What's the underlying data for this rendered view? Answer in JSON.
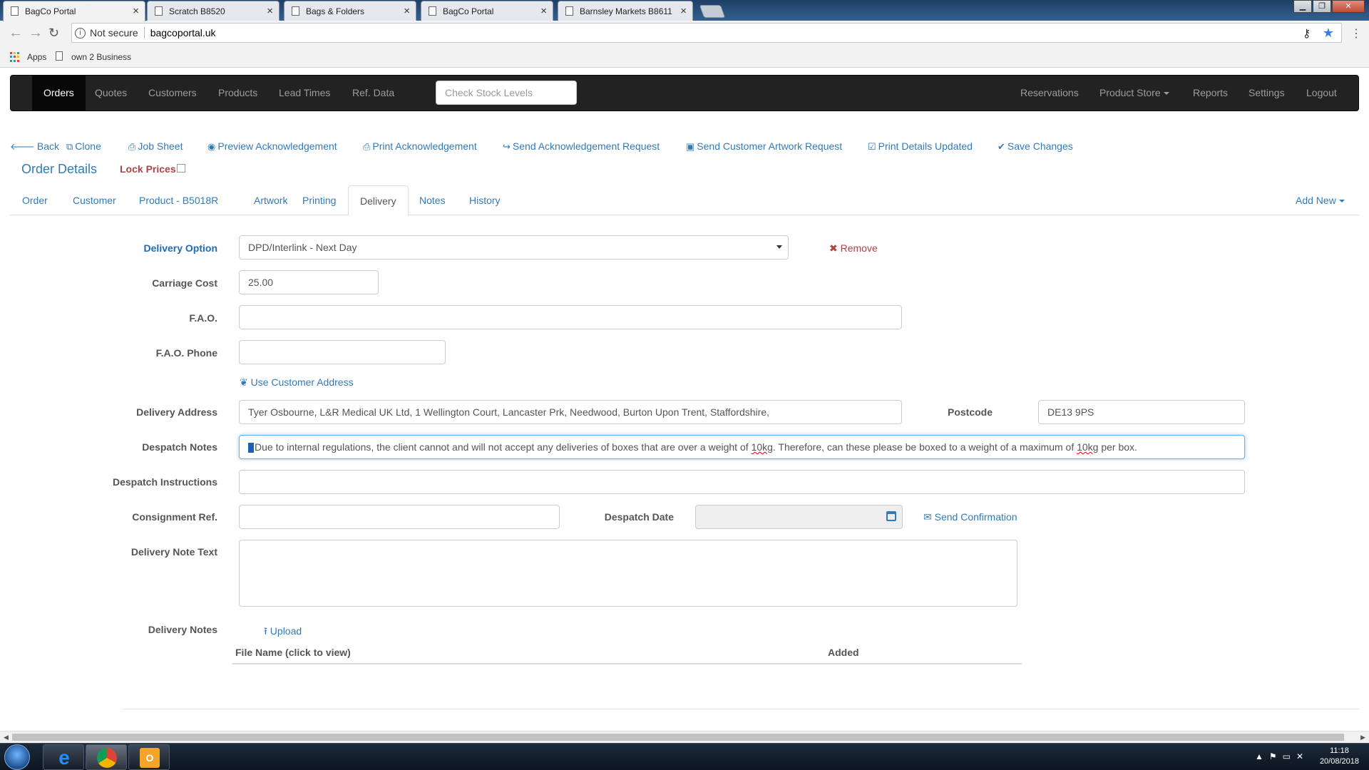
{
  "browser": {
    "tabs": [
      {
        "title": "BagCo Portal",
        "active": true
      },
      {
        "title": "Scratch B8520",
        "active": false
      },
      {
        "title": "Bags & Folders",
        "active": false
      },
      {
        "title": "BagCo Portal",
        "active": false
      },
      {
        "title": "Barnsley Markets B8611",
        "active": false
      }
    ],
    "security_label": "Not secure",
    "url": "bagcoportal.uk",
    "bookmarks": [
      "Apps",
      "own 2 Business"
    ]
  },
  "navbar": {
    "left_items": [
      "Orders",
      "Quotes",
      "Customers",
      "Products",
      "Lead Times",
      "Ref. Data"
    ],
    "active": "Orders",
    "search_placeholder": "Check Stock Levels",
    "right_items": [
      "Reservations",
      "Product Store",
      "Reports",
      "Settings",
      "Logout"
    ]
  },
  "toolbar": {
    "back": "Back",
    "clone": "Clone",
    "job_sheet": "Job Sheet",
    "preview_ack": "Preview Acknowledgement",
    "print_ack": "Print Acknowledgement",
    "send_ack_request": "Send Acknowledgement Request",
    "send_artwork_request": "Send Customer Artwork Request",
    "print_details_updated": "Print Details Updated",
    "save_changes": "Save Changes"
  },
  "header": {
    "title": "Order Details",
    "lock_prices": "Lock Prices"
  },
  "tabs": {
    "items": [
      "Order",
      "Customer",
      "Product - B5018R",
      "Artwork",
      "Printing",
      "Delivery",
      "Notes",
      "History"
    ],
    "active": "Delivery",
    "add_new": "Add New"
  },
  "form": {
    "delivery_option": {
      "label": "Delivery Option",
      "value": "DPD/Interlink - Next Day",
      "remove": "Remove"
    },
    "carriage_cost": {
      "label": "Carriage Cost",
      "value": "25.00"
    },
    "fao": {
      "label": "F.A.O.",
      "value": ""
    },
    "fao_phone": {
      "label": "F.A.O. Phone",
      "value": ""
    },
    "use_customer_address": "Use Customer Address",
    "delivery_address": {
      "label": "Delivery Address",
      "value": "Tyer Osbourne, L&R Medical UK Ltd, 1 Wellington Court, Lancaster Prk, Needwood, Burton Upon Trent, Staffordshire,"
    },
    "postcode": {
      "label": "Postcode",
      "value": "DE13 9PS"
    },
    "despatch_notes": {
      "label": "Despatch Notes",
      "part1": "Due to internal regulations, the client cannot and will not accept any deliveries of boxes that are over a weight of ",
      "misspelled1": "10kg",
      "part2": ". Therefore, can these please be boxed to a weight of a maximum of ",
      "misspelled2": "10kg",
      "part3": " per box."
    },
    "despatch_instructions": {
      "label": "Despatch Instructions",
      "value": ""
    },
    "consignment_ref": {
      "label": "Consignment Ref.",
      "value": ""
    },
    "despatch_date": {
      "label": "Despatch Date",
      "value": ""
    },
    "send_confirmation": "Send Confirmation",
    "delivery_note_text": {
      "label": "Delivery Note Text",
      "value": ""
    },
    "delivery_notes": {
      "label": "Delivery Notes",
      "upload": "Upload",
      "columns": [
        "File Name (click to view)",
        "Added"
      ]
    }
  },
  "taskbar": {
    "time": "11:18",
    "date": "20/08/2018"
  },
  "colors": {
    "link": "#337ab7",
    "navbar": "#222222",
    "danger": "#a94442",
    "focus": "#66afe9"
  }
}
